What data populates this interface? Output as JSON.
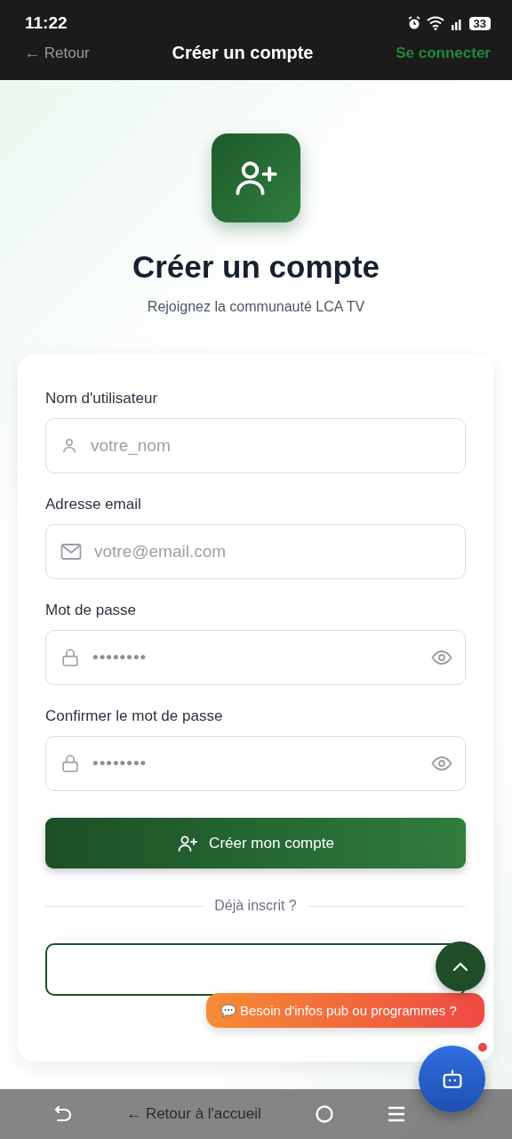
{
  "status_bar": {
    "time": "11:22",
    "battery": "33"
  },
  "header": {
    "back": "← Retour",
    "title": "Créer un compte",
    "login": "Se connecter"
  },
  "hero": {
    "title": "Créer un compte",
    "subtitle": "Rejoignez la communauté LCA TV"
  },
  "fields": [
    {
      "label": "Nom d'utilisateur",
      "kind": "user",
      "placeholder": "votre_nom"
    },
    {
      "label": "Adresse email",
      "kind": "email",
      "placeholder": "votre@email.com"
    },
    {
      "label": "Mot de passe",
      "kind": "password",
      "value": "••••••••"
    },
    {
      "label": "Confirmer le mot de passe",
      "kind": "password",
      "value": "••••••••"
    }
  ],
  "submit": "Créer mon compte",
  "divider": "Déjà inscrit ?",
  "tooltip": "Besoin d'infos pub ou programmes ?",
  "chatbot": {
    "notification": true
  },
  "home_link": "← Retour à l'accueil"
}
